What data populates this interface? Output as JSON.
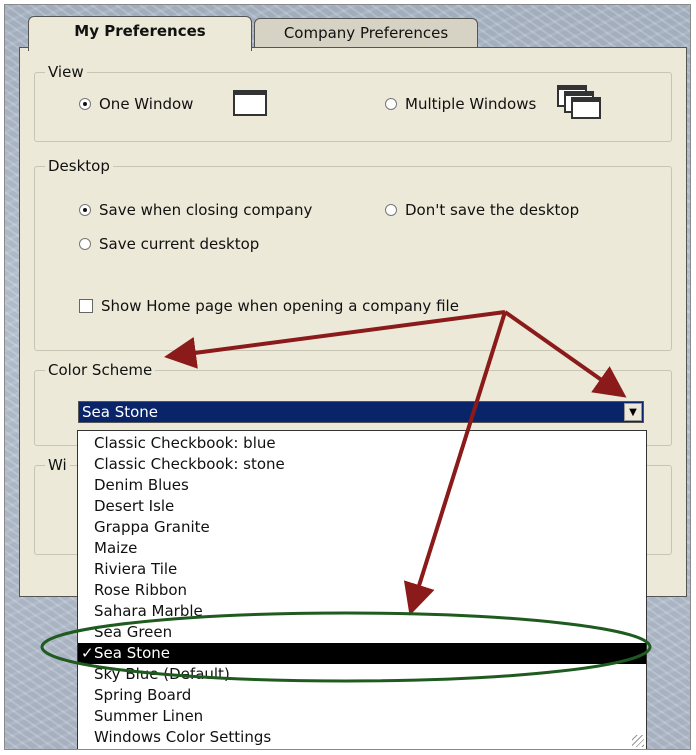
{
  "tabs": {
    "my_preferences": "My Preferences",
    "company_preferences": "Company Preferences"
  },
  "view": {
    "legend": "View",
    "one_window": "One Window",
    "multiple_windows": "Multiple Windows",
    "selected": "one_window"
  },
  "desktop": {
    "legend": "Desktop",
    "save_when_closing": "Save when closing company",
    "dont_save": "Don't save the desktop",
    "save_current": "Save current desktop",
    "show_home_page": "Show Home page when opening a company file",
    "show_home_page_checked": false
  },
  "color_scheme": {
    "legend": "Color Scheme",
    "selected_value": "Sea Stone",
    "options": [
      "Classic Checkbook: blue",
      "Classic Checkbook: stone",
      "Denim Blues",
      "Desert Isle",
      "Grappa Granite",
      "Maize",
      "Riviera Tile",
      "Rose Ribbon",
      "Sahara Marble",
      "Sea Green",
      "Sea Stone",
      "Sky Blue (Default)",
      "Spring Board",
      "Summer Linen",
      "Windows Color Settings"
    ],
    "check_mark": "✓"
  },
  "windows_group": {
    "legend": "Wi"
  },
  "colors": {
    "annotation_arrow": "#8b1a1a",
    "annotation_ellipse": "#1f5a1f",
    "selection_bar": "#0a246a"
  }
}
